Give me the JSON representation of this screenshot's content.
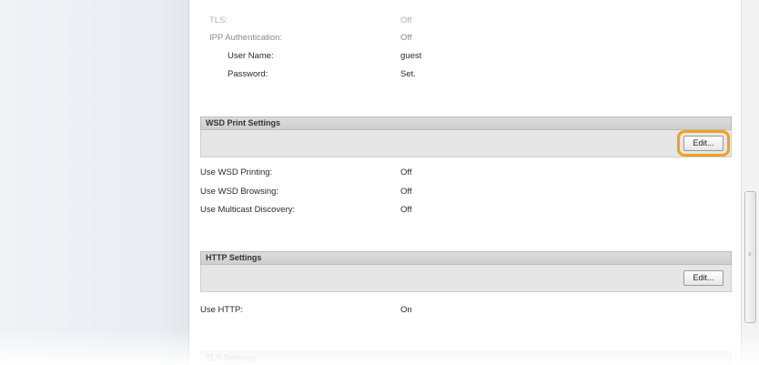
{
  "top_settings": {
    "tls": {
      "label": "TLS:",
      "value": "Off"
    },
    "ipp_authentication": {
      "label": "IPP Authentication:",
      "value": "Off"
    },
    "user_name": {
      "label": "User Name:",
      "value": "guest"
    },
    "password": {
      "label": "Password:",
      "value": "Set."
    }
  },
  "wsd_section": {
    "header": "WSD Print Settings",
    "edit_label": "Edit...",
    "rows": [
      {
        "label": "Use WSD Printing:",
        "value": "Off"
      },
      {
        "label": "Use WSD Browsing:",
        "value": "Off"
      },
      {
        "label": "Use Multicast Discovery:",
        "value": "Off"
      }
    ]
  },
  "http_section": {
    "header": "HTTP Settings",
    "edit_label": "Edit...",
    "rows": [
      {
        "label": "Use HTTP:",
        "value": "On"
      }
    ]
  },
  "tls_section": {
    "header": "TLS Settings"
  },
  "colors": {
    "highlight": "#f0a020",
    "header_bg": "#d6d6d6",
    "nav_bg": "#eceff3"
  }
}
